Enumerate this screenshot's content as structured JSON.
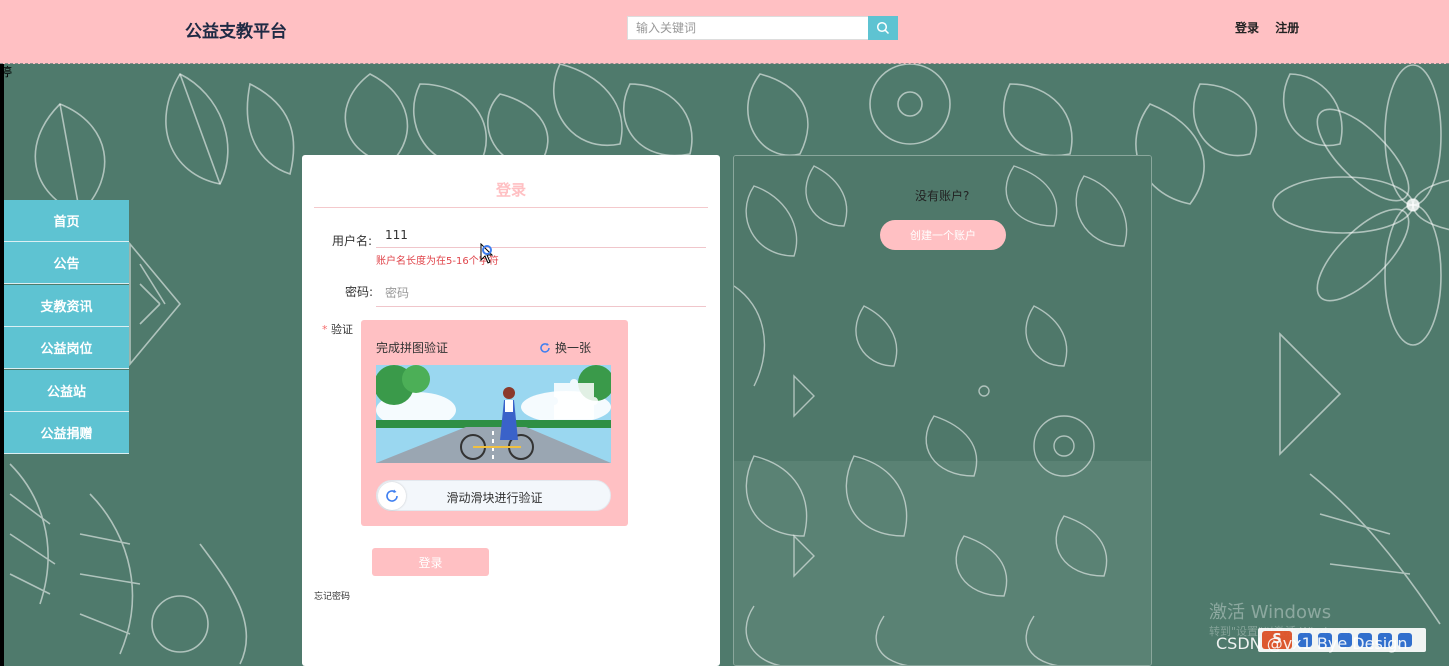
{
  "header": {
    "brand": "公益支教平台",
    "search_placeholder": "输入关键词",
    "search_icon": "search-icon",
    "login_link": "登录",
    "register_link": "注册"
  },
  "edge_char": "停",
  "sidenav": {
    "items": [
      "首页",
      "公告",
      "支教资讯",
      "公益岗位",
      "公益站",
      "公益捐赠"
    ]
  },
  "login": {
    "title": "登录",
    "username_label": "用户名:",
    "username_value": "111",
    "username_error": "账户名长度为在5-16个字符",
    "password_label": "密码:",
    "password_placeholder": "密码",
    "captcha_label_star": "*",
    "captcha_label": "验证",
    "captcha_title": "完成拼图验证",
    "captcha_refresh": "换一张",
    "slider_hint": "滑动滑块进行验证",
    "submit": "登录",
    "forgot": "忘记密码"
  },
  "register": {
    "question": "没有账户?",
    "create_button": "创建一个账户"
  },
  "overlays": {
    "watermark_line1": "激活 Windows",
    "watermark_line2": "转到\"设置\"以激活 Windows。",
    "csdn": "CSDN @vx1 Bye Design",
    "ime_logo": "S"
  },
  "colors": {
    "header_bg": "#ffc0c3",
    "accent_pink": "#ffc0c3",
    "nav_teal": "#5ec3d2",
    "chalkboard_green": "#4f7a6c",
    "error_red": "#e0454b"
  }
}
